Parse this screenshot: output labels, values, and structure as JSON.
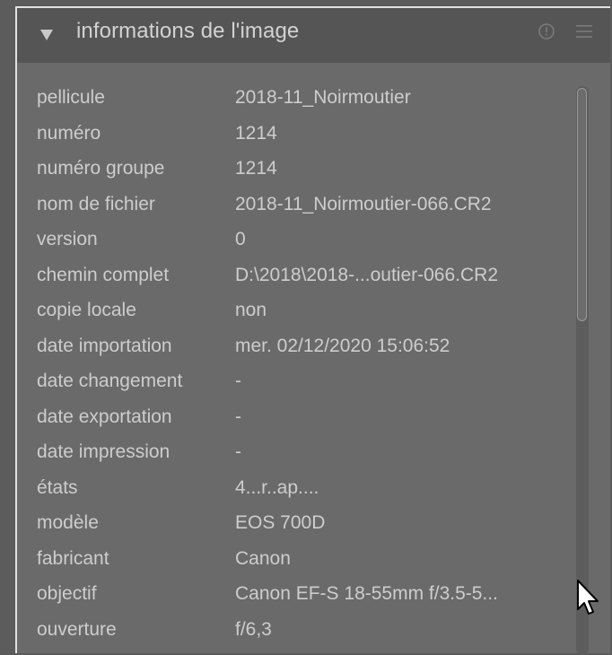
{
  "panel": {
    "title": "informations de l'image",
    "icons": {
      "collapse": "triangle-down-icon",
      "info": "info-circle-icon",
      "menu": "hamburger-menu-icon"
    }
  },
  "rows": [
    {
      "label": "pellicule",
      "value": "2018-11_Noirmoutier"
    },
    {
      "label": "numéro",
      "value": "1214"
    },
    {
      "label": "numéro groupe",
      "value": "1214"
    },
    {
      "label": "nom de fichier",
      "value": "2018-11_Noirmoutier-066.CR2"
    },
    {
      "label": "version",
      "value": "0"
    },
    {
      "label": "chemin complet",
      "value": "D:\\2018\\2018-...outier-066.CR2"
    },
    {
      "label": "copie locale",
      "value": "non"
    },
    {
      "label": "date importation",
      "value": "mer. 02/12/2020 15:06:52"
    },
    {
      "label": "date changement",
      "value": "-"
    },
    {
      "label": "date exportation",
      "value": "-"
    },
    {
      "label": "date impression",
      "value": "-"
    },
    {
      "label": "états",
      "value": "4...r..ap...."
    },
    {
      "label": "modèle",
      "value": "EOS 700D"
    },
    {
      "label": "fabricant",
      "value": "Canon"
    },
    {
      "label": "objectif",
      "value": "Canon EF-S 18-55mm f/3.5-5..."
    },
    {
      "label": "ouverture",
      "value": "f/6,3"
    }
  ],
  "colors": {
    "panel_bg": "#6a6a6a",
    "header_bg": "#555555",
    "text": "#cdcdcd"
  }
}
